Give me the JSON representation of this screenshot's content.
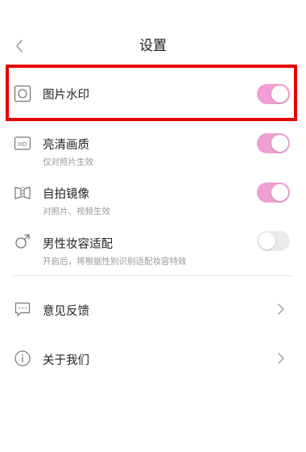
{
  "header": {
    "title": "设置",
    "back_icon": "chevron-left-icon"
  },
  "settings": [
    {
      "label": "图片水印",
      "subtitle": "",
      "icon": "square-circle-icon",
      "toggle_on": true
    },
    {
      "label": "亮清画质",
      "subtitle": "仅对照片生效",
      "icon": "hd-icon",
      "toggle_on": true
    },
    {
      "label": "自拍镜像",
      "subtitle": "对照片、视频生效",
      "icon": "mirror-icon",
      "toggle_on": true
    },
    {
      "label": "男性妆容适配",
      "subtitle": "开启后，将根据性别识别适配妆容特效",
      "icon": "male-icon",
      "toggle_on": false
    }
  ],
  "links": [
    {
      "label": "意见反馈",
      "icon": "feedback-icon",
      "chevron_icon": "chevron-right-icon"
    },
    {
      "label": "关于我们",
      "icon": "info-icon",
      "chevron_icon": "chevron-right-icon"
    }
  ],
  "colors": {
    "toggle_on": "#ef9fd4",
    "toggle_off": "#ebebeb",
    "highlight_border": "#e60000"
  }
}
